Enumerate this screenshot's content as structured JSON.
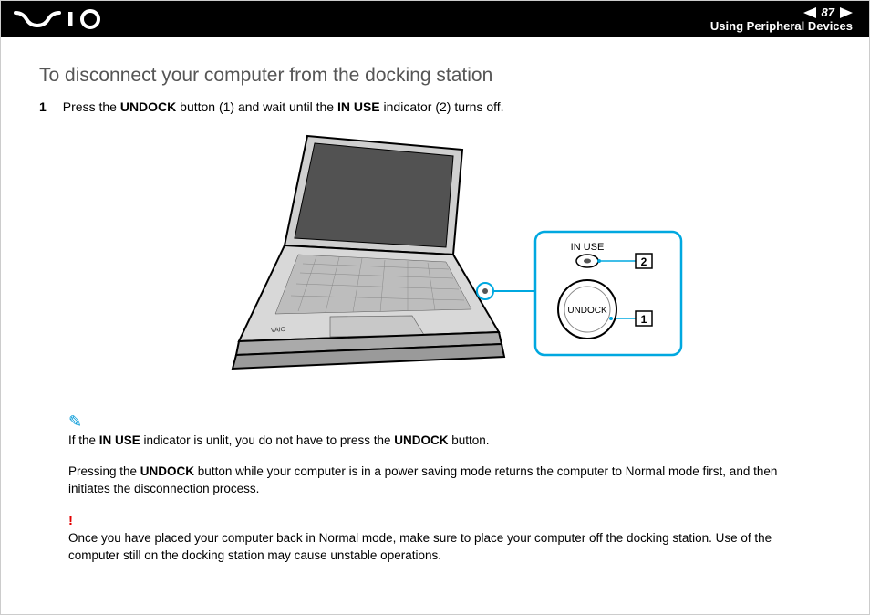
{
  "header": {
    "page_number": "87",
    "breadcrumb": "Using Peripheral Devices"
  },
  "main": {
    "title": "To disconnect your computer from the docking station",
    "step1_num": "1",
    "step1_a": "Press the ",
    "step1_b": "UNDOCK",
    "step1_c": " button (1) and wait until the ",
    "step1_d": "IN USE",
    "step1_e": " indicator (2) turns off."
  },
  "figure": {
    "inuse_label": "IN USE",
    "undock_label": "UNDOCK",
    "callout1": "1",
    "callout2": "2"
  },
  "notes": {
    "n1_a": "If the ",
    "n1_b": "IN USE",
    "n1_c": " indicator is unlit, you do not have to press the ",
    "n1_d": "UNDOCK",
    "n1_e": " button.",
    "n2_a": "Pressing the ",
    "n2_b": "UNDOCK",
    "n2_c": " button while your computer is in a power saving mode returns the computer to Normal mode first, and then initiates the disconnection process.",
    "n3": "Once you have placed your computer back in Normal mode, make sure to place your computer off the docking station. Use of the computer still on the docking station may cause unstable operations."
  }
}
